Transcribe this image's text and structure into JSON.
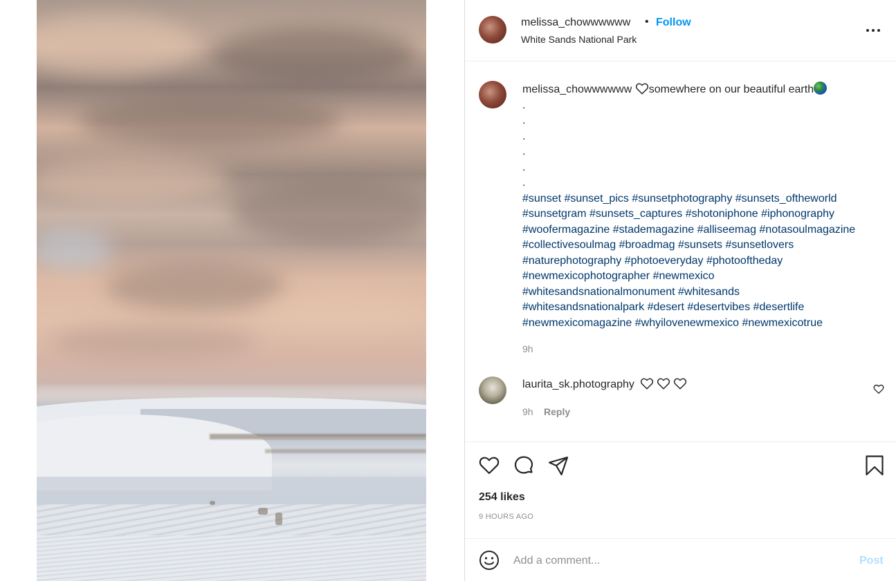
{
  "post": {
    "image_alt": "Sunset over White Sands dunes",
    "header": {
      "username": "melissa_chowwwwww",
      "separator": "•",
      "follow_label": "Follow",
      "location": "White Sands National Park",
      "more_icon": "more-options-icon"
    },
    "caption": {
      "username": "melissa_chowwwwww",
      "text": "somewhere on our beautiful earth",
      "heart_icon": "heart-outline-icon",
      "globe_icon": "globe-emoji-icon",
      "dots": [
        ".",
        ".",
        ".",
        ".",
        ".",
        "."
      ],
      "hashtag_lines": [
        "#sunset #sunset_pics #sunsetphotography #sunsets_oftheworld",
        "#sunsetgram #sunsets_captures #shotoniphone #iphonography",
        "#woofermagazine #stademagazine #alliseemag #notasoulmagazine",
        "#collectivesoulmag #broadmag #sunsets #sunsetlovers",
        "#naturephotography #photoeveryday #photooftheday",
        "#newmexicophotographer #newmexico",
        "#whitesandsnationalmonument #whitesands",
        "#whitesandsnationalpark #desert #desertvibes #desertlife",
        "#newmexicomagazine #whyilovenewmexico #newmexicotrue"
      ],
      "time": "9h"
    },
    "comments": [
      {
        "username": "laurita_sk.photography",
        "time": "9h",
        "reply_label": "Reply",
        "hearts": 3
      }
    ],
    "likes": "254 likes",
    "posted_ago": "9 HOURS AGO",
    "comment_box": {
      "placeholder": "Add a comment...",
      "post_label": "Post"
    },
    "colors": {
      "accent": "#0095f6",
      "hashtag": "#00376b",
      "muted": "#8e8e8e",
      "post_disabled": "#b2dffc"
    }
  }
}
